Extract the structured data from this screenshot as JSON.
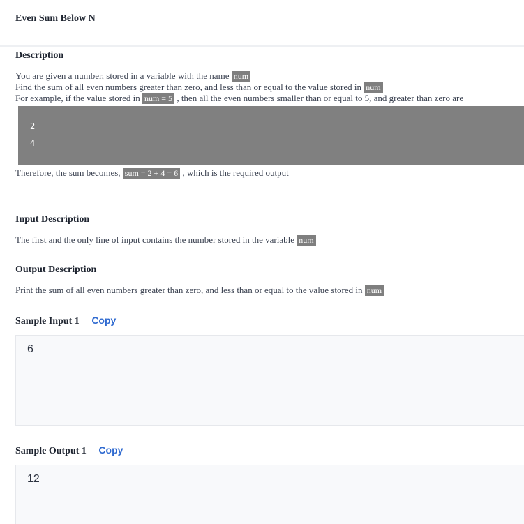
{
  "problem": {
    "title": "Even Sum Below N"
  },
  "description": {
    "heading": "Description",
    "line1": {
      "before": "You are given a number, stored in a variable with the name",
      "code": "num"
    },
    "line2": {
      "before": "Find the sum of all even numbers greater than zero, and less than or equal to the value stored in",
      "code": "num"
    },
    "line3": {
      "before": "For example, if the value stored in",
      "code": "num = 5",
      "after": ", then all the even numbers smaller than or equal to 5, and greater than zero are"
    },
    "example_lines": [
      "2",
      "4"
    ],
    "line4": {
      "before": "Therefore, the sum becomes,",
      "code": "sum = 2 + 4 = 6",
      "after": ", which is the required output"
    }
  },
  "input_description": {
    "heading": "Input Description",
    "text": "The first and the only line of input contains the number stored in the variable",
    "code": "num"
  },
  "output_description": {
    "heading": "Output Description",
    "text": "Print the sum of all even numbers greater than zero, and less than or equal to the value stored in",
    "code": "num"
  },
  "samples": {
    "input": {
      "heading": "Sample Input 1",
      "copy_label": "Copy",
      "value": "6"
    },
    "output": {
      "heading": "Sample Output 1",
      "copy_label": "Copy",
      "value": "12"
    }
  }
}
